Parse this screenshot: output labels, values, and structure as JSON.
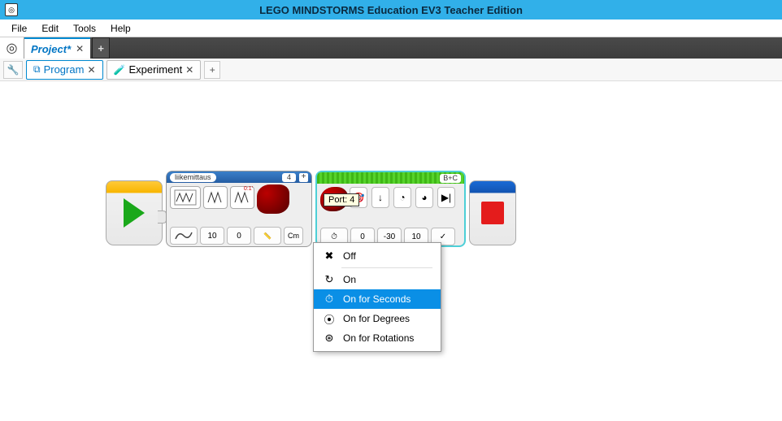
{
  "titlebar": {
    "title": "LEGO MINDSTORMS Education EV3 Teacher Edition"
  },
  "menubar": {
    "file": "File",
    "edit": "Edit",
    "tools": "Tools",
    "help": "Help"
  },
  "project_tabs": {
    "active_label": "Project*"
  },
  "sub_tabs": {
    "program": "Program",
    "experiment": "Experiment"
  },
  "tooltip": {
    "port": "Port: 4"
  },
  "data_block": {
    "header_name": "liikemittaus",
    "header_port": "4",
    "header_plus": "+",
    "foot_val1": "10",
    "foot_val2": "0",
    "foot_unit": "Cm"
  },
  "motor_block": {
    "ports": "B+C",
    "mode_icon": "⏱",
    "val1": "0",
    "val2": "-30",
    "val3": "10",
    "val4": "✓"
  },
  "dropdown": {
    "off": "Off",
    "on": "On",
    "on_seconds": "On for Seconds",
    "on_degrees": "On for Degrees",
    "on_rotations": "On for Rotations"
  }
}
